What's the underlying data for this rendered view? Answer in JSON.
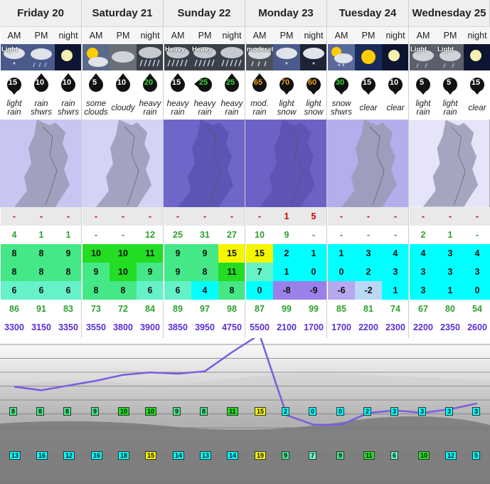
{
  "days": [
    {
      "name": "Friday 20",
      "periods": [
        {
          "tod": "AM",
          "icon": "light-snow-icon",
          "icon_text": "Light",
          "wind": "15",
          "wind_color": "#000000",
          "wind_dir": "down",
          "desc": "light rain",
          "snow_cm": "-",
          "rain_mm": "4",
          "temp_max": "8",
          "temp_min": "8",
          "chill": "6",
          "humidity": "86",
          "freezing": "3300"
        },
        {
          "tod": "PM",
          "icon": "rain-showers-icon",
          "icon_text": "",
          "wind": "10",
          "wind_color": "#000000",
          "wind_dir": "up",
          "desc": "rain shwrs",
          "snow_cm": "-",
          "rain_mm": "1",
          "temp_max": "8",
          "temp_min": "8",
          "chill": "6",
          "humidity": "91",
          "freezing": "3150"
        },
        {
          "tod": "night",
          "icon": "moon-icon",
          "icon_text": "",
          "wind": "10",
          "wind_color": "#000000",
          "wind_dir": "up",
          "desc": "rain shwrs",
          "snow_cm": "-",
          "rain_mm": "1",
          "temp_max": "9",
          "temp_min": "8",
          "chill": "6",
          "humidity": "83",
          "freezing": "3350"
        }
      ]
    },
    {
      "name": "Saturday 21",
      "periods": [
        {
          "tod": "AM",
          "icon": "sun-cloud-icon",
          "icon_text": "",
          "wind": "5",
          "wind_color": "#000000",
          "wind_dir": "up",
          "desc": "some clouds",
          "snow_cm": "-",
          "rain_mm": "-",
          "temp_max": "10",
          "temp_min": "9",
          "chill": "8",
          "humidity": "73",
          "freezing": "3550"
        },
        {
          "tod": "PM",
          "icon": "cloud-icon",
          "icon_text": "",
          "wind": "10",
          "wind_color": "#000000",
          "wind_dir": "up",
          "desc": "cloudy",
          "snow_cm": "-",
          "rain_mm": "-",
          "temp_max": "10",
          "temp_min": "10",
          "chill": "8",
          "humidity": "72",
          "freezing": "3800"
        },
        {
          "tod": "night",
          "icon": "heavy-rain-icon",
          "icon_text": "",
          "wind": "20",
          "wind_color": "#3ad63a",
          "wind_dir": "up",
          "desc": "heavy rain",
          "snow_cm": "-",
          "rain_mm": "12",
          "temp_max": "11",
          "temp_min": "9",
          "chill": "6",
          "humidity": "84",
          "freezing": "3900"
        }
      ]
    },
    {
      "name": "Sunday 22",
      "periods": [
        {
          "tod": "AM",
          "icon": "heavy-rain-icon",
          "icon_text": "Heavy",
          "wind": "15",
          "wind_color": "#000000",
          "wind_dir": "up",
          "desc": "heavy rain",
          "snow_cm": "-",
          "rain_mm": "25",
          "temp_max": "9",
          "temp_min": "9",
          "chill": "6",
          "humidity": "89",
          "freezing": "3850"
        },
        {
          "tod": "PM",
          "icon": "heavy-rain-icon",
          "icon_text": "Heavy",
          "wind": "25",
          "wind_color": "#3ad63a",
          "wind_dir": "left",
          "desc": "heavy rain",
          "snow_cm": "-",
          "rain_mm": "31",
          "temp_max": "9",
          "temp_min": "8",
          "chill": "4",
          "humidity": "97",
          "freezing": "3950"
        },
        {
          "tod": "night",
          "icon": "heavy-rain-icon",
          "icon_text": "",
          "wind": "25",
          "wind_color": "#3ad63a",
          "wind_dir": "up",
          "desc": "heavy rain",
          "snow_cm": "-",
          "rain_mm": "27",
          "temp_max": "15",
          "temp_min": "11",
          "chill": "8",
          "humidity": "98",
          "freezing": "4750"
        }
      ]
    },
    {
      "name": "Monday 23",
      "periods": [
        {
          "tod": "AM",
          "icon": "moderate-rain-icon",
          "icon_text": "moderate",
          "wind": "65",
          "wind_color": "#f0a020",
          "wind_dir": "up",
          "desc": "mod. rain",
          "snow_cm": "-",
          "rain_mm": "10",
          "temp_max": "15",
          "temp_min": "7",
          "chill": "0",
          "humidity": "87",
          "freezing": "5500"
        },
        {
          "tod": "PM",
          "icon": "light-snow-icon",
          "icon_text": "",
          "wind": "70",
          "wind_color": "#f0a020",
          "wind_dir": "down",
          "desc": "light snow",
          "snow_cm": "1",
          "rain_mm": "9",
          "temp_max": "2",
          "temp_min": "1",
          "chill": "-8",
          "humidity": "99",
          "freezing": "2100"
        },
        {
          "tod": "night",
          "icon": "light-snow-night-icon",
          "icon_text": "",
          "wind": "60",
          "wind_color": "#f0a020",
          "wind_dir": "down",
          "desc": "light snow",
          "snow_cm": "5",
          "rain_mm": "-",
          "temp_max": "1",
          "temp_min": "0",
          "chill": "-9",
          "humidity": "99",
          "freezing": "1700"
        }
      ]
    },
    {
      "name": "Tuesday 24",
      "periods": [
        {
          "tod": "AM",
          "icon": "snow-showers-icon",
          "icon_text": "",
          "wind": "30",
          "wind_color": "#3ad63a",
          "wind_dir": "down",
          "desc": "snow shwrs",
          "snow_cm": "-",
          "rain_mm": "-",
          "temp_max": "1",
          "temp_min": "0",
          "chill": "-6",
          "humidity": "85",
          "freezing": "1700"
        },
        {
          "tod": "PM",
          "icon": "sun-icon",
          "icon_text": "",
          "wind": "15",
          "wind_color": "#000000",
          "wind_dir": "down",
          "desc": "clear",
          "snow_cm": "-",
          "rain_mm": "-",
          "temp_max": "3",
          "temp_min": "2",
          "chill": "-2",
          "humidity": "81",
          "freezing": "2200"
        },
        {
          "tod": "night",
          "icon": "moon-icon",
          "icon_text": "",
          "wind": "10",
          "wind_color": "#000000",
          "wind_dir": "down",
          "desc": "clear",
          "snow_cm": "-",
          "rain_mm": "-",
          "temp_max": "4",
          "temp_min": "3",
          "chill": "1",
          "humidity": "74",
          "freezing": "2300"
        }
      ]
    },
    {
      "name": "Wednesday 25",
      "periods": [
        {
          "tod": "AM",
          "icon": "light-rain-icon",
          "icon_text": "Light",
          "wind": "5",
          "wind_color": "#000000",
          "wind_dir": "down",
          "desc": "light rain",
          "snow_cm": "-",
          "rain_mm": "2",
          "temp_max": "4",
          "temp_min": "3",
          "chill": "3",
          "humidity": "67",
          "freezing": "2200"
        },
        {
          "tod": "PM",
          "icon": "light-rain-icon",
          "icon_text": "Light",
          "wind": "5",
          "wind_color": "#000000",
          "wind_dir": "down",
          "desc": "light rain",
          "snow_cm": "-",
          "rain_mm": "1",
          "temp_max": "3",
          "temp_min": "3",
          "chill": "1",
          "humidity": "80",
          "freezing": "2350"
        },
        {
          "tod": "night",
          "icon": "moon-icon",
          "icon_text": "",
          "wind": "15",
          "wind_color": "#000000",
          "wind_dir": "down",
          "desc": "clear",
          "snow_cm": "-",
          "rain_mm": "-",
          "temp_max": "4",
          "temp_min": "3",
          "chill": "0",
          "humidity": "54",
          "freezing": "2600"
        }
      ]
    }
  ],
  "chart": {
    "upper_labels": [
      "8",
      "8",
      "8",
      "9",
      "10",
      "10",
      "9",
      "8",
      "11",
      "15",
      "2",
      "0",
      "0",
      "2",
      "3",
      "3",
      "3",
      "3"
    ],
    "lower_labels": [
      "13",
      "16",
      "12",
      "16",
      "18",
      "15",
      "14",
      "13",
      "14",
      "19",
      "9",
      "7",
      "9",
      "11",
      "6",
      "10",
      "12",
      "5"
    ]
  },
  "colors": {
    "temp_scale": {
      "-9": "#9a80e8",
      "-8": "#9a80e8",
      "-6": "#b7a8f0",
      "-2": "#b9d8f5",
      "0": "#00ffff",
      "1": "#00ffff",
      "2": "#00ffff",
      "3": "#00ffff",
      "4": "#00ffff",
      "6": "#66f2c8",
      "7": "#66f2c8",
      "8": "#44e886",
      "9": "#44e886",
      "10": "#22dd22",
      "11": "#22dd22",
      "15": "#f5f500",
      "19": "#f5f500"
    },
    "freeze_line": "#7b5ce0",
    "snow_red": "#d00000",
    "rain_green": "#2da02d",
    "humidity_green": "#2da02d",
    "freezing_purple": "#5b2ed8"
  }
}
